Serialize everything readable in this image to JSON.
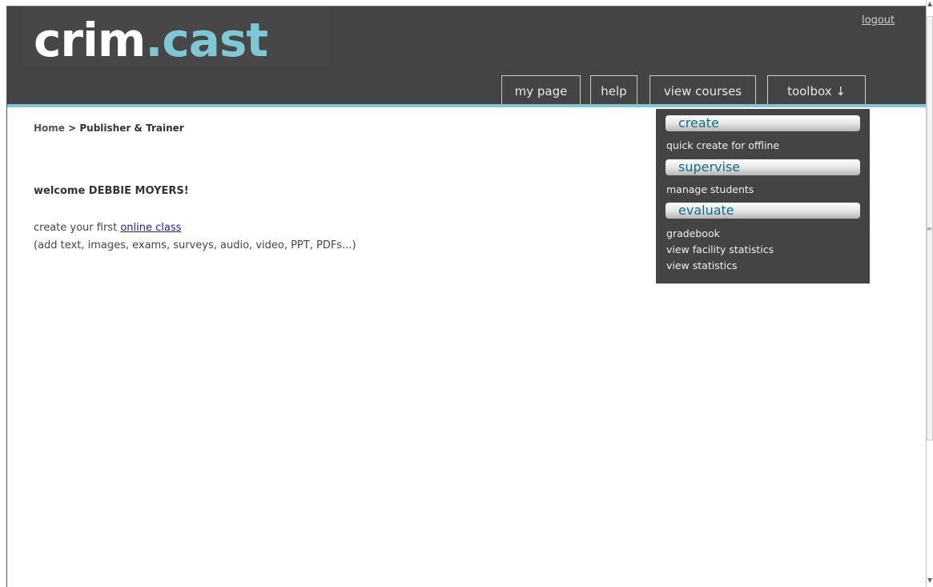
{
  "brand": {
    "logo_main": "crim",
    "logo_dot": ".",
    "logo_accent": "cast",
    "accent_color": "#7ec8d6",
    "header_color": "#444444"
  },
  "header": {
    "logout_label": "logout"
  },
  "nav": {
    "tabs": [
      {
        "label": "my page"
      },
      {
        "label": "help"
      },
      {
        "label": "view courses"
      },
      {
        "label": "toolbox ↓"
      }
    ]
  },
  "breadcrumb": {
    "home": "Home",
    "separator": " > ",
    "current": "Publisher & Trainer"
  },
  "main": {
    "welcome": "welcome DEBBIE MOYERS!",
    "create_prefix": "create your first ",
    "create_link": "online class",
    "hint": "(add text, images, exams, surveys, audio, video, PPT, PDFs...)"
  },
  "toolbox_menu": {
    "sections": [
      {
        "header": "create",
        "items": [
          "quick create for offline"
        ]
      },
      {
        "header": "supervise",
        "items": [
          "manage students"
        ]
      },
      {
        "header": "evaluate",
        "items": [
          "gradebook",
          "view facility statistics",
          "view statistics"
        ]
      }
    ]
  },
  "scrollbar": {
    "up_icon": "arrow-up-icon",
    "down_icon": "arrow-down-icon",
    "grip_icon": "grip-icon"
  }
}
